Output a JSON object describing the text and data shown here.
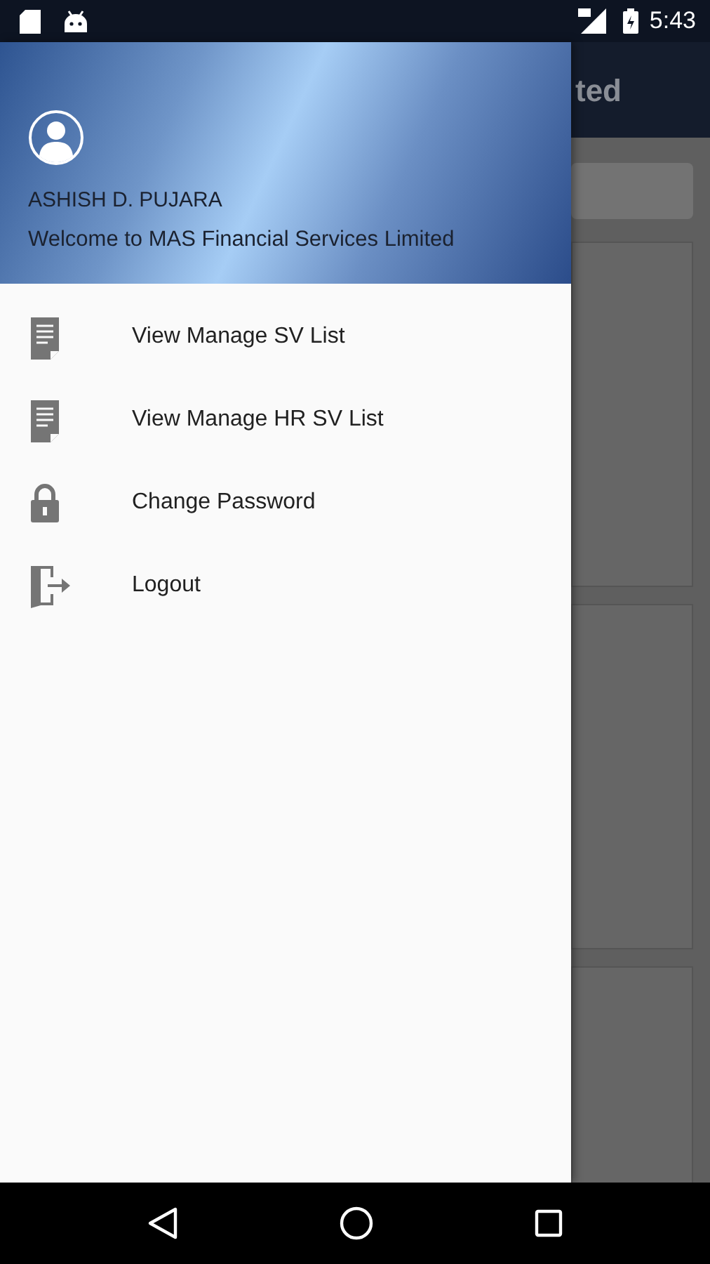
{
  "status_bar": {
    "time": "5:43"
  },
  "background_app": {
    "title": "ted"
  },
  "drawer": {
    "header": {
      "user_name": "ASHISH D. PUJARA",
      "welcome": "Welcome to MAS Financial Services Limited"
    },
    "items": [
      {
        "kind": "document",
        "label": "View Manage SV List"
      },
      {
        "kind": "document",
        "label": "View Manage HR SV List"
      },
      {
        "kind": "lock",
        "label": "Change Password"
      },
      {
        "kind": "logout",
        "label": "Logout"
      }
    ]
  }
}
